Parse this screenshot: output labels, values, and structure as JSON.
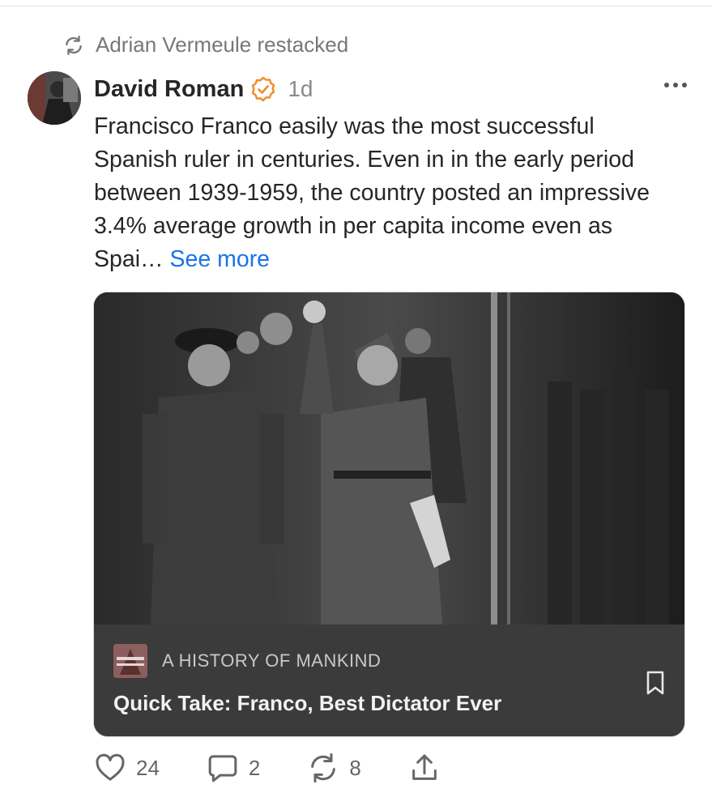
{
  "restack": {
    "text": "Adrian Vermeule restacked",
    "icon": "restack-icon"
  },
  "post": {
    "author": "David Roman",
    "verified_icon": "verified-check-icon",
    "time": "1d",
    "more_icon": "more-horizontal-icon",
    "body": "Francisco Franco easily was the most successful Spanish ruler in centuries. Even in in the early period between 1939-1959, the country posted an impressive 3.4% average growth in per capita income even as Spai…",
    "see_more": "See more"
  },
  "card": {
    "publication": "A HISTORY OF MANKIND",
    "logo_text": "HISTORY OF MANKIND",
    "title": "Quick Take: Franco, Best Dictator Ever",
    "bookmark_icon": "bookmark-icon"
  },
  "actions": {
    "likes": "24",
    "comments": "2",
    "restacks": "8"
  },
  "colors": {
    "link": "#1a73e8",
    "verified": "#f08b22",
    "card_footer": "#3b3b3b"
  }
}
